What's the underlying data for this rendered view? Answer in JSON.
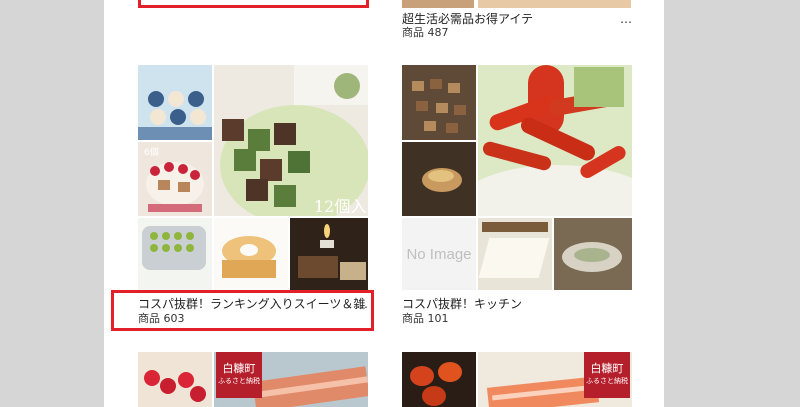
{
  "colors": {
    "accent_red": "#e3202a",
    "background_gray": "#d6d6d6"
  },
  "cards": [
    {
      "title": "超生活必需品お得アイテ",
      "ellipsis": "…",
      "count": "商品 487"
    },
    {
      "title": "コスパ抜群！ランキング入りスイーツ＆雑",
      "ellipsis": "…",
      "count": "商品 603",
      "highlighted": true
    },
    {
      "title": "コスパ抜群！キッチン",
      "count": "商品 101"
    }
  ],
  "images": {
    "sweets_count_badge": "6個",
    "sweets_main_badge": "12個入",
    "no_image_label": "No Image",
    "seal_label": "白糠町",
    "seal_sub": "ふるさと納税"
  }
}
